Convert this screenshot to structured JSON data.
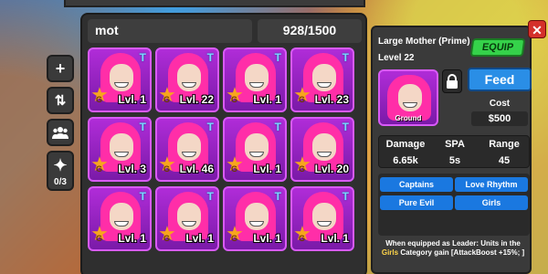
{
  "search": {
    "value": "mot"
  },
  "capacity": "928/1500",
  "toolbar": {
    "equipped_count": "0/3"
  },
  "cards": [
    {
      "tier": "T",
      "rarity": "G",
      "level": "Lvl. 1"
    },
    {
      "tier": "T",
      "rarity": "G",
      "level": "Lvl. 22"
    },
    {
      "tier": "T",
      "rarity": "G",
      "level": "Lvl. 1"
    },
    {
      "tier": "T",
      "rarity": "G",
      "level": "Lvl. 23"
    },
    {
      "tier": "T",
      "rarity": "G",
      "level": "Lvl. 3"
    },
    {
      "tier": "T",
      "rarity": "G",
      "level": "Lvl. 46"
    },
    {
      "tier": "T",
      "rarity": "G",
      "level": "Lvl. 1"
    },
    {
      "tier": "T",
      "rarity": "G",
      "level": "Lvl. 20"
    },
    {
      "tier": "T",
      "rarity": "G",
      "level": "Lvl. 1"
    },
    {
      "tier": "T",
      "rarity": "G",
      "level": "Lvl. 1"
    },
    {
      "tier": "T",
      "rarity": "G",
      "level": "Lvl. 1"
    },
    {
      "tier": "T",
      "rarity": "G",
      "level": "Lvl. 1"
    }
  ],
  "detail": {
    "name": "Large Mother (Prime)",
    "level": "Level 22",
    "equip_label": "EQUIP",
    "feed_label": "Feed",
    "placement": "Ground",
    "cost_label": "Cost",
    "cost_value": "$500",
    "stats": {
      "damage_label": "Damage",
      "damage_value": "6.65k",
      "spa_label": "SPA",
      "spa_value": "5s",
      "range_label": "Range",
      "range_value": "45"
    },
    "traits": [
      "Captains",
      "Love Rhythm",
      "Pure Evil",
      "Girls"
    ],
    "leader_prefix": "When equipped as Leader: Units in the",
    "leader_highlight": "Girls",
    "leader_suffix": "Category gain [AttackBoost +15%; ]"
  },
  "close_label": "✕"
}
